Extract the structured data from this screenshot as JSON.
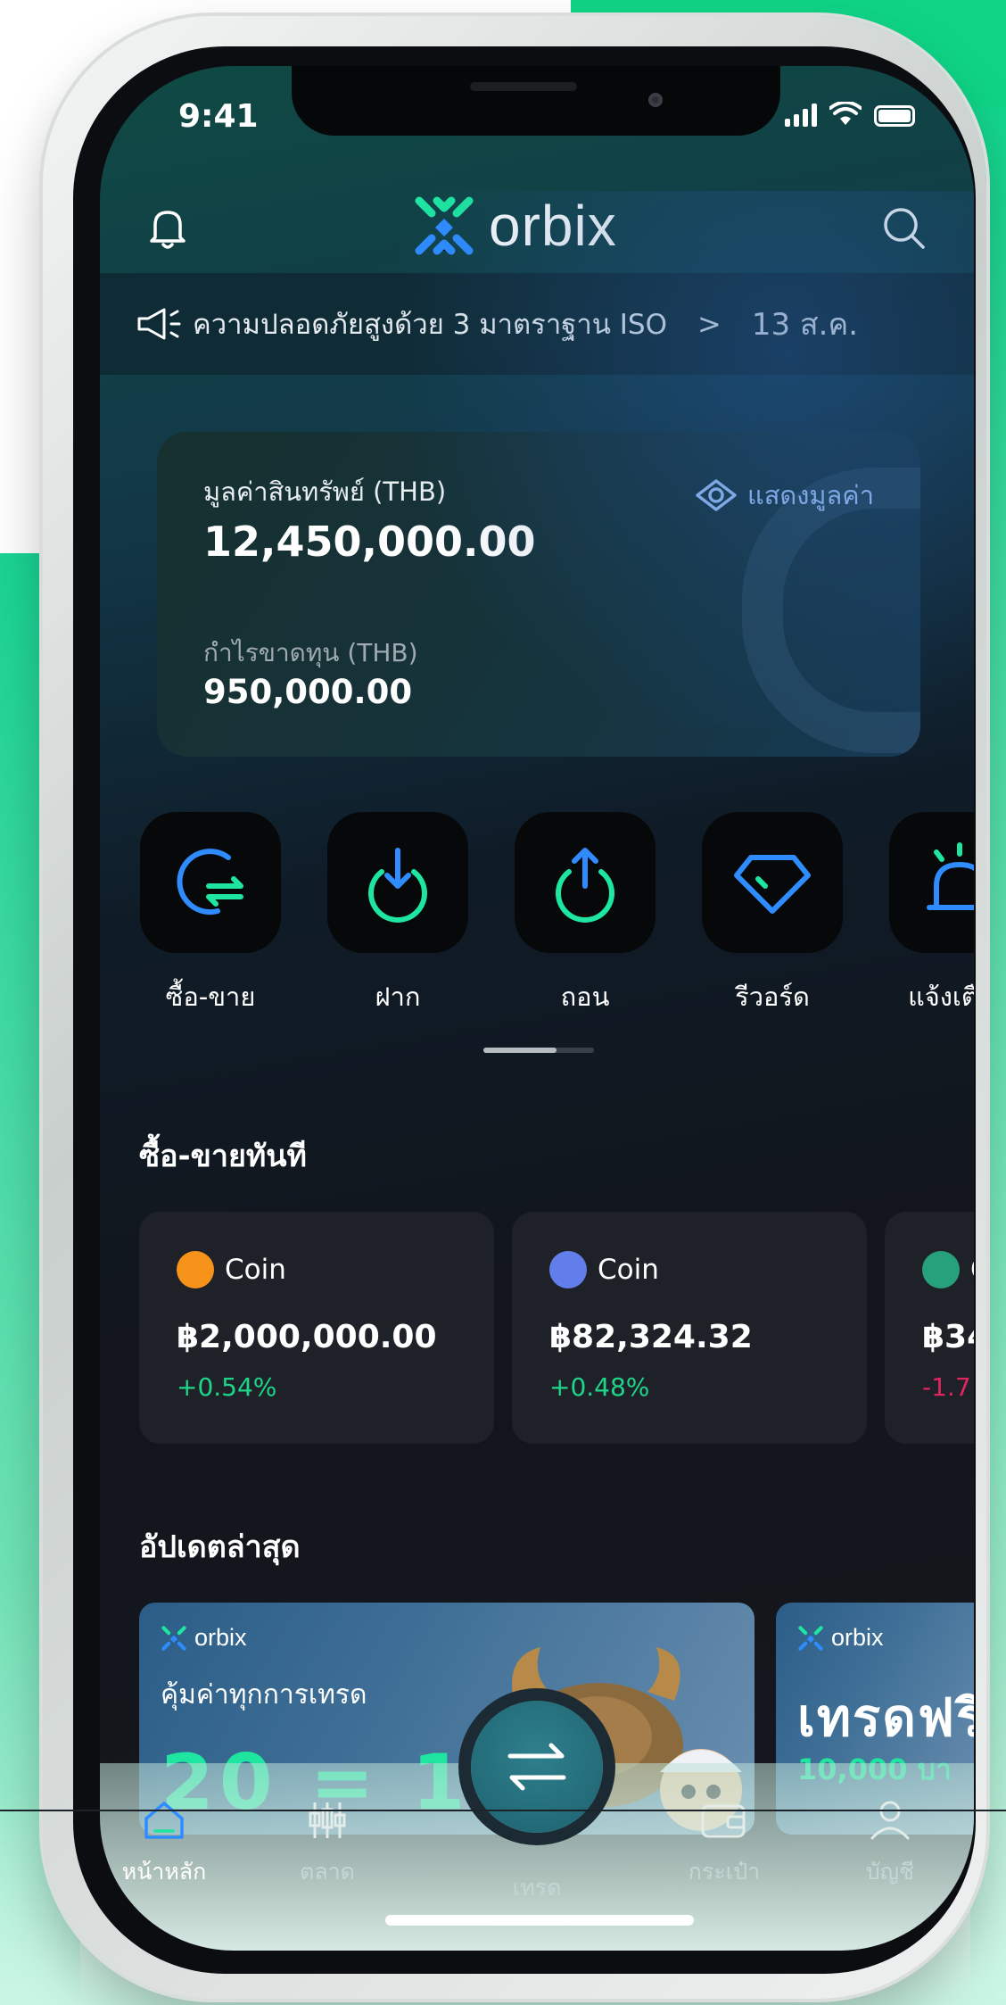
{
  "status_bar": {
    "time": "9:41"
  },
  "header": {
    "brand": "orbix"
  },
  "announcement": {
    "text": "ความปลอดภัยสูงด้วย 3 มาตราฐาน ISO",
    "arrow": ">",
    "date": "13 ส.ค."
  },
  "asset_card": {
    "asset_label": "มูลค่าสินทรัพย์ (THB)",
    "asset_value": "12,450,000.00",
    "show_value_label": "แสดงมูลค่า",
    "pl_label": "กำไรขาดทุน (THB)",
    "pl_value": "950,000.00"
  },
  "quick_actions": [
    {
      "label": "ซื้อ-ขาย",
      "icon": "exchange-icon"
    },
    {
      "label": "ฝาก",
      "icon": "deposit-icon"
    },
    {
      "label": "ถอน",
      "icon": "withdraw-icon"
    },
    {
      "label": "รีวอร์ด",
      "icon": "diamond-icon"
    },
    {
      "label": "แจ้งเตือน",
      "icon": "alarm-icon"
    }
  ],
  "instant_trade": {
    "title": "ซื้อ-ขายทันที",
    "coins": [
      {
        "name": "Coin",
        "price": "฿2,000,000.00",
        "change": "+0.54%",
        "color": "#f7931a",
        "change_color": "#1ed68a"
      },
      {
        "name": "Coin",
        "price": "฿82,324.32",
        "change": "+0.48%",
        "color": "#627eea",
        "change_color": "#1ed68a"
      },
      {
        "name": "C",
        "price": "฿34",
        "change": "-1.7",
        "color": "#26a17b",
        "change_color": "#e0245e"
      }
    ]
  },
  "updates": {
    "title": "อัปเดตล่าสุด",
    "banners": [
      {
        "brand": "orbix",
        "text": "คุ้มค่าทุกการเทรด",
        "big": "20 = 1"
      },
      {
        "brand": "orbix",
        "big": "เทรดฟรี",
        "sub": "10,000 บา"
      }
    ]
  },
  "tabbar": {
    "items": [
      {
        "label": "หน้าหลัก",
        "icon": "home-icon"
      },
      {
        "label": "ตลาด",
        "icon": "market-icon"
      },
      {
        "label": "เทรด",
        "icon": "trade-icon"
      },
      {
        "label": "กระเป๋า",
        "icon": "wallet-icon"
      },
      {
        "label": "บัญชี",
        "icon": "account-icon"
      }
    ]
  },
  "colors": {
    "accent_green": "#1ed68a",
    "accent_blue": "#2f8cff",
    "negative_red": "#e0245e"
  }
}
